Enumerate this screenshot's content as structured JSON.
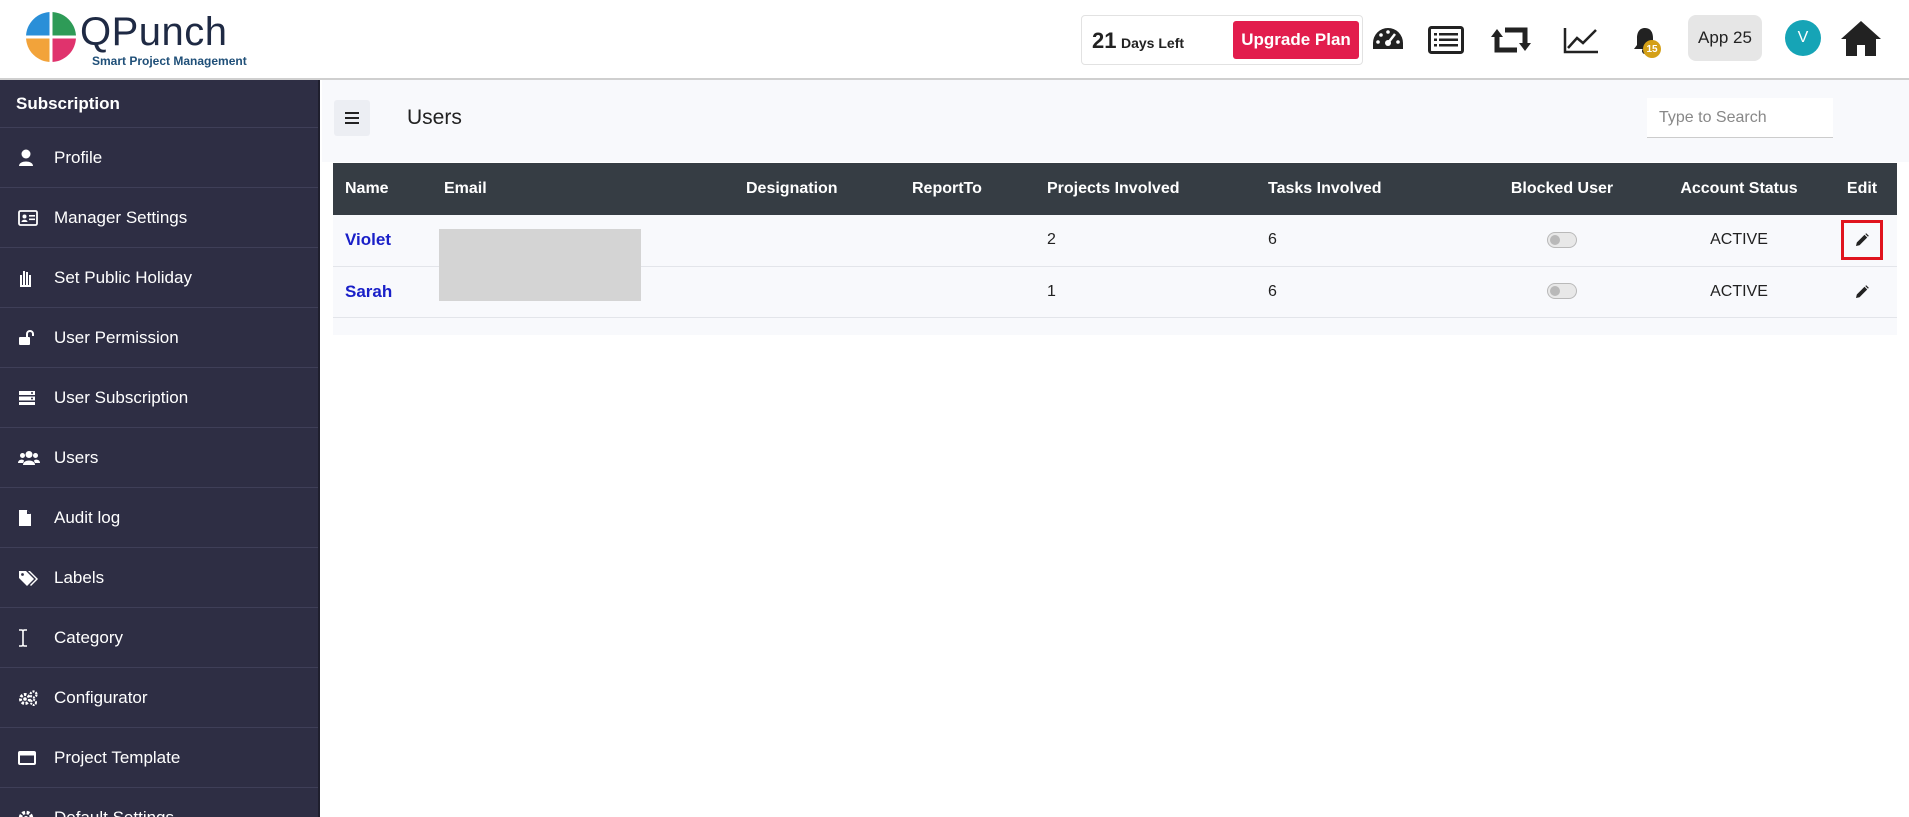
{
  "app": {
    "logo_text": "QPunch",
    "tagline": "Smart Project Management"
  },
  "header": {
    "days_left_number": "21",
    "days_left_label": "Days Left",
    "upgrade_label": "Upgrade Plan",
    "notification_count": "15",
    "app_button_label": "App 25",
    "avatar_initial": "V"
  },
  "sidebar": {
    "title": "Subscription",
    "items": [
      {
        "label": "Profile",
        "icon": "user-icon"
      },
      {
        "label": "Manager Settings",
        "icon": "id-card-icon"
      },
      {
        "label": "Set Public Holiday",
        "icon": "hand-icon"
      },
      {
        "label": "User Permission",
        "icon": "unlock-icon"
      },
      {
        "label": "User Subscription",
        "icon": "server-icon"
      },
      {
        "label": "Users",
        "icon": "users-icon"
      },
      {
        "label": "Audit log",
        "icon": "file-icon"
      },
      {
        "label": "Labels",
        "icon": "tags-icon"
      },
      {
        "label": "Category",
        "icon": "i-cursor-icon"
      },
      {
        "label": "Configurator",
        "icon": "cogs-icon"
      },
      {
        "label": "Project Template",
        "icon": "window-icon"
      },
      {
        "label": "Default Settings",
        "icon": "gear-icon"
      }
    ]
  },
  "main": {
    "title": "Users",
    "search_placeholder": "Type to Search",
    "columns": [
      "Name",
      "Email",
      "Designation",
      "ReportTo",
      "Projects Involved",
      "Tasks Involved",
      "Blocked User",
      "Account Status",
      "Edit"
    ],
    "rows": [
      {
        "name": "Violet",
        "email": "",
        "designation": "",
        "report_to": "",
        "projects": "2",
        "tasks": "6",
        "blocked": false,
        "status": "ACTIVE"
      },
      {
        "name": "Sarah",
        "email": "",
        "designation": "",
        "report_to": "",
        "projects": "1",
        "tasks": "6",
        "blocked": false,
        "status": "ACTIVE"
      }
    ]
  },
  "colors": {
    "sidebar_bg": "#2e2e44",
    "table_header_bg": "#363d44",
    "upgrade_btn": "#e21d4d",
    "name_link": "#1a20c8",
    "avatar_bg": "#16a4b6",
    "highlight": "#e0141e"
  }
}
